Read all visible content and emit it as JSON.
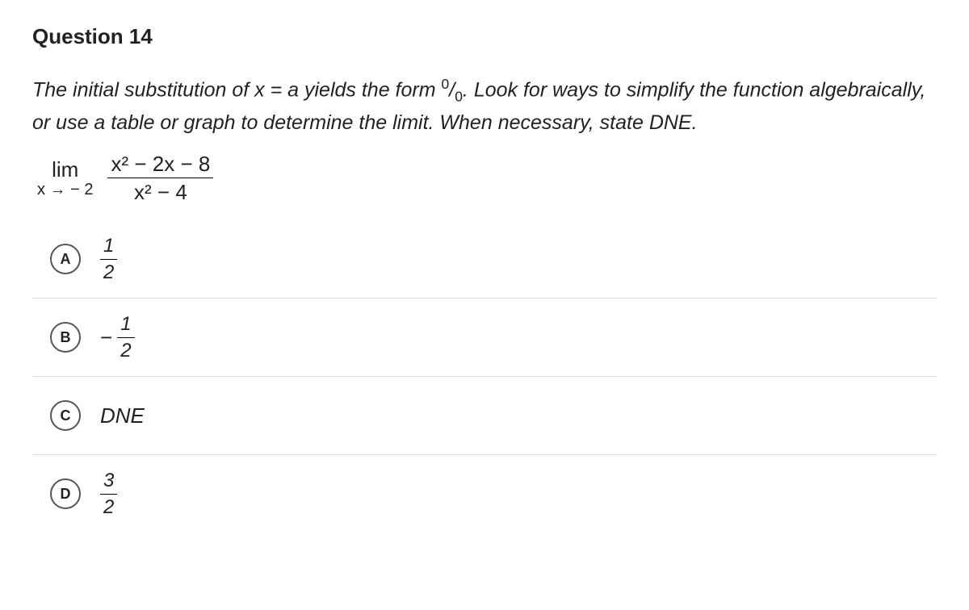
{
  "title": "Question 14",
  "prompt": {
    "line1": "The initial substitution of x = a yields the form ",
    "form_num": "0",
    "form_div": "/",
    "form_den": "0",
    "line1b": ". Look for ways to simplify the",
    "line2": "function algebraically, or use a table or graph to determine the limit. When",
    "line3": "necessary, state DNE."
  },
  "limit": {
    "lim": "lim",
    "approach": "x → − 2",
    "numerator": "x² − 2x − 8",
    "denominator": "x² − 4"
  },
  "options": [
    {
      "letter": "A",
      "type": "fraction",
      "sign": "",
      "num": "1",
      "den": "2"
    },
    {
      "letter": "B",
      "type": "fraction",
      "sign": "−",
      "num": "1",
      "den": "2"
    },
    {
      "letter": "C",
      "type": "text",
      "text": "DNE"
    },
    {
      "letter": "D",
      "type": "fraction",
      "sign": "",
      "num": "3",
      "den": "2"
    }
  ]
}
